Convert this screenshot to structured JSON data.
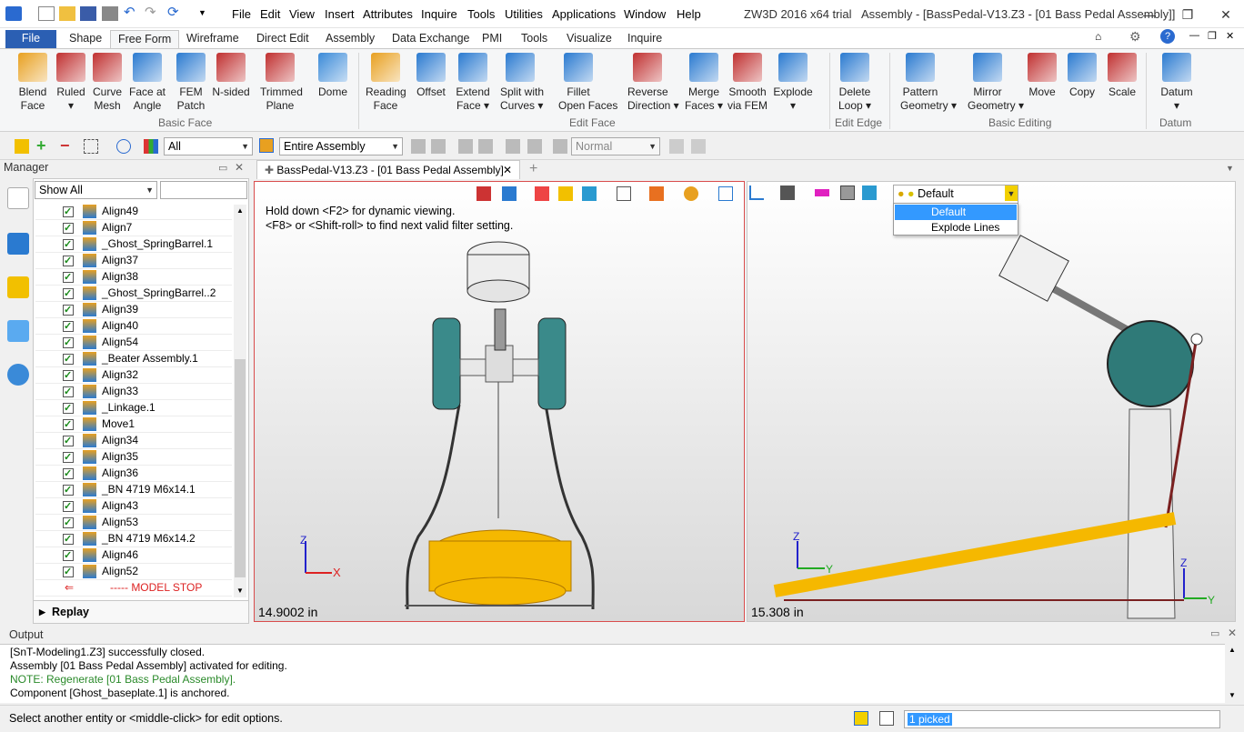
{
  "menu": [
    "File",
    "Edit",
    "View",
    "Insert",
    "Attributes",
    "Inquire",
    "Tools",
    "Utilities",
    "Applications",
    "Window",
    "Help"
  ],
  "app_title": "ZW3D 2016  x64 trial",
  "doc_title": "Assembly - [BassPedal-V13.Z3 - [01 Bass Pedal Assembly]]",
  "ribbon_tabs": [
    "File",
    "Shape",
    "Free Form",
    "Wireframe",
    "Direct Edit",
    "Assembly",
    "Data Exchange",
    "PMI",
    "Tools",
    "Visualize",
    "Inquire"
  ],
  "active_tab": "Free Form",
  "ribbon": {
    "basic_face": {
      "label": "Basic Face",
      "buttons": [
        {
          "l1": "Blend",
          "l2": "Face",
          "color": "#e8a020"
        },
        {
          "l1": "Ruled",
          "l2": "▾",
          "color": "#c03030"
        },
        {
          "l1": "Curve",
          "l2": "Mesh",
          "color": "#c03030"
        },
        {
          "l1": "Face at",
          "l2": "Angle",
          "color": "#2a7ad0"
        },
        {
          "l1": "FEM",
          "l2": "Patch",
          "color": "#2a7ad0"
        },
        {
          "l1": "N-sided",
          "l2": "",
          "color": "#c03030"
        },
        {
          "l1": "Trimmed",
          "l2": "Plane",
          "color": "#c03030"
        },
        {
          "l1": "Dome",
          "l2": "",
          "color": "#3a8ad8"
        }
      ]
    },
    "edit_face": {
      "label": "Edit Face",
      "buttons": [
        {
          "l1": "Reading",
          "l2": "Face",
          "color": "#e8a020"
        },
        {
          "l1": "Offset",
          "l2": "",
          "color": "#2a7ad0"
        },
        {
          "l1": "Extend",
          "l2": "Face ▾",
          "color": "#2a7ad0"
        },
        {
          "l1": "Split with",
          "l2": "Curves ▾",
          "color": "#2a7ad0"
        },
        {
          "l1": "Fillet",
          "l2": "Open Faces",
          "color": "#2a7ad0"
        },
        {
          "l1": "Reverse",
          "l2": "Direction ▾",
          "color": "#c03030"
        },
        {
          "l1": "Merge",
          "l2": "Faces ▾",
          "color": "#2a7ad0"
        },
        {
          "l1": "Smooth",
          "l2": "via FEM",
          "color": "#c03030"
        },
        {
          "l1": "Explode",
          "l2": "▾",
          "color": "#2a7ad0"
        }
      ]
    },
    "edit_edge": {
      "label": "Edit Edge",
      "buttons": [
        {
          "l1": "Delete",
          "l2": "Loop ▾",
          "color": "#2a7ad0"
        }
      ]
    },
    "basic_editing": {
      "label": "Basic Editing",
      "buttons": [
        {
          "l1": "Pattern",
          "l2": "Geometry ▾",
          "color": "#2a7ad0"
        },
        {
          "l1": "Mirror",
          "l2": "Geometry ▾",
          "color": "#2a7ad0"
        },
        {
          "l1": "Move",
          "l2": "",
          "color": "#c03030"
        },
        {
          "l1": "Copy",
          "l2": "",
          "color": "#2a7ad0"
        },
        {
          "l1": "Scale",
          "l2": "",
          "color": "#c03030"
        }
      ]
    },
    "datum": {
      "label": "Datum",
      "buttons": [
        {
          "l1": "Datum",
          "l2": "▾",
          "color": "#2a7ad0"
        }
      ]
    }
  },
  "filter": {
    "all": "All",
    "scope": "Entire Assembly",
    "render": "Normal"
  },
  "manager": {
    "title": "Manager",
    "show": "Show All",
    "items": [
      "Align49",
      "Align7",
      "_Ghost_SpringBarrel.1",
      "Align37",
      "Align38",
      "_Ghost_SpringBarrel..2",
      "Align39",
      "Align40",
      "Align54",
      "_Beater Assembly.1",
      "Align32",
      "Align33",
      "_Linkage.1",
      "Move1",
      "Align34",
      "Align35",
      "Align36",
      "_BN 4719 M6x14.1",
      "Align43",
      "Align53",
      "_BN 4719 M6x14.2",
      "Align46",
      "Align52"
    ],
    "stop": "----- MODEL STOP HERE -----",
    "replay": "Replay"
  },
  "doc_tab": "BassPedal-V13.Z3 - [01 Bass Pedal Assembly]",
  "viewport1": {
    "hint1": "Hold down <F2> for dynamic viewing.",
    "hint2": "<F8> or <Shift-roll> to find next valid filter setting.",
    "dim": "14.9002 in"
  },
  "viewport2": {
    "dim": "15.308 in",
    "combo": "Default",
    "options": [
      "Default",
      "Explode Lines"
    ]
  },
  "output": {
    "title": "Output",
    "lines": [
      "[SnT-Modeling1.Z3] successfully closed.",
      "Assembly [01 Bass Pedal Assembly] activated for editing.",
      "NOTE: Regenerate [01 Bass Pedal Assembly].",
      "Component [Ghost_baseplate.1] is anchored."
    ]
  },
  "status": {
    "msg": "Select another entity or <middle-click> for edit options.",
    "picked": "1 picked"
  }
}
